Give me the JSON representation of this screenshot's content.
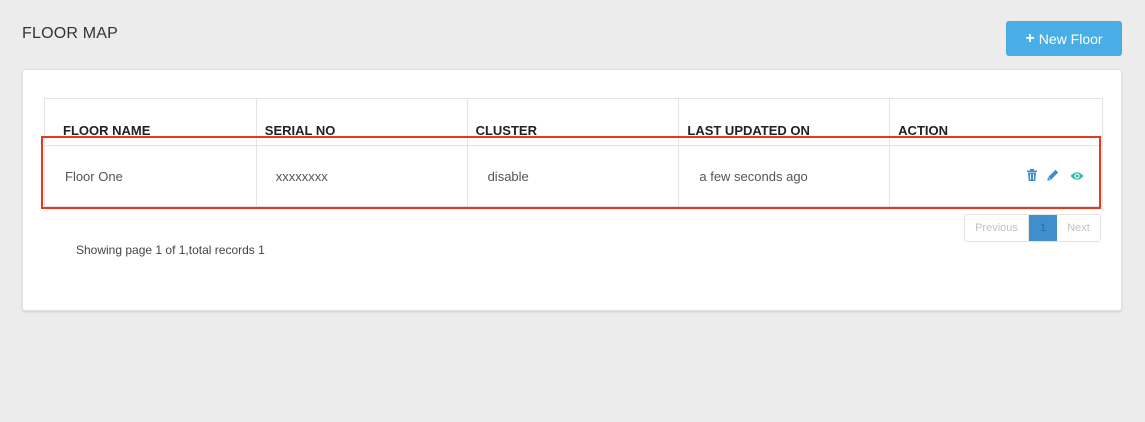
{
  "header": {
    "title": "FLOOR MAP",
    "new_button_icon": "plus-icon",
    "new_button_label": "New Floor",
    "accent": "#4aaee6"
  },
  "table": {
    "columns": [
      "FLOOR NAME",
      "SERIAL NO",
      "CLUSTER",
      "LAST UPDATED ON",
      "ACTION"
    ],
    "rows": [
      {
        "floor_name": "Floor One",
        "serial_no": "xxxxxxxx",
        "cluster": "disable",
        "last_updated": "a few seconds ago",
        "actions": [
          "trash-icon",
          "pencil-icon",
          "eye-icon"
        ]
      }
    ],
    "highlight_color": "#e2391f"
  },
  "pagination": {
    "previous_label": "Previous",
    "current_page": "1",
    "next_label": "Next",
    "summary": "Showing page 1 of 1,total records 1"
  }
}
